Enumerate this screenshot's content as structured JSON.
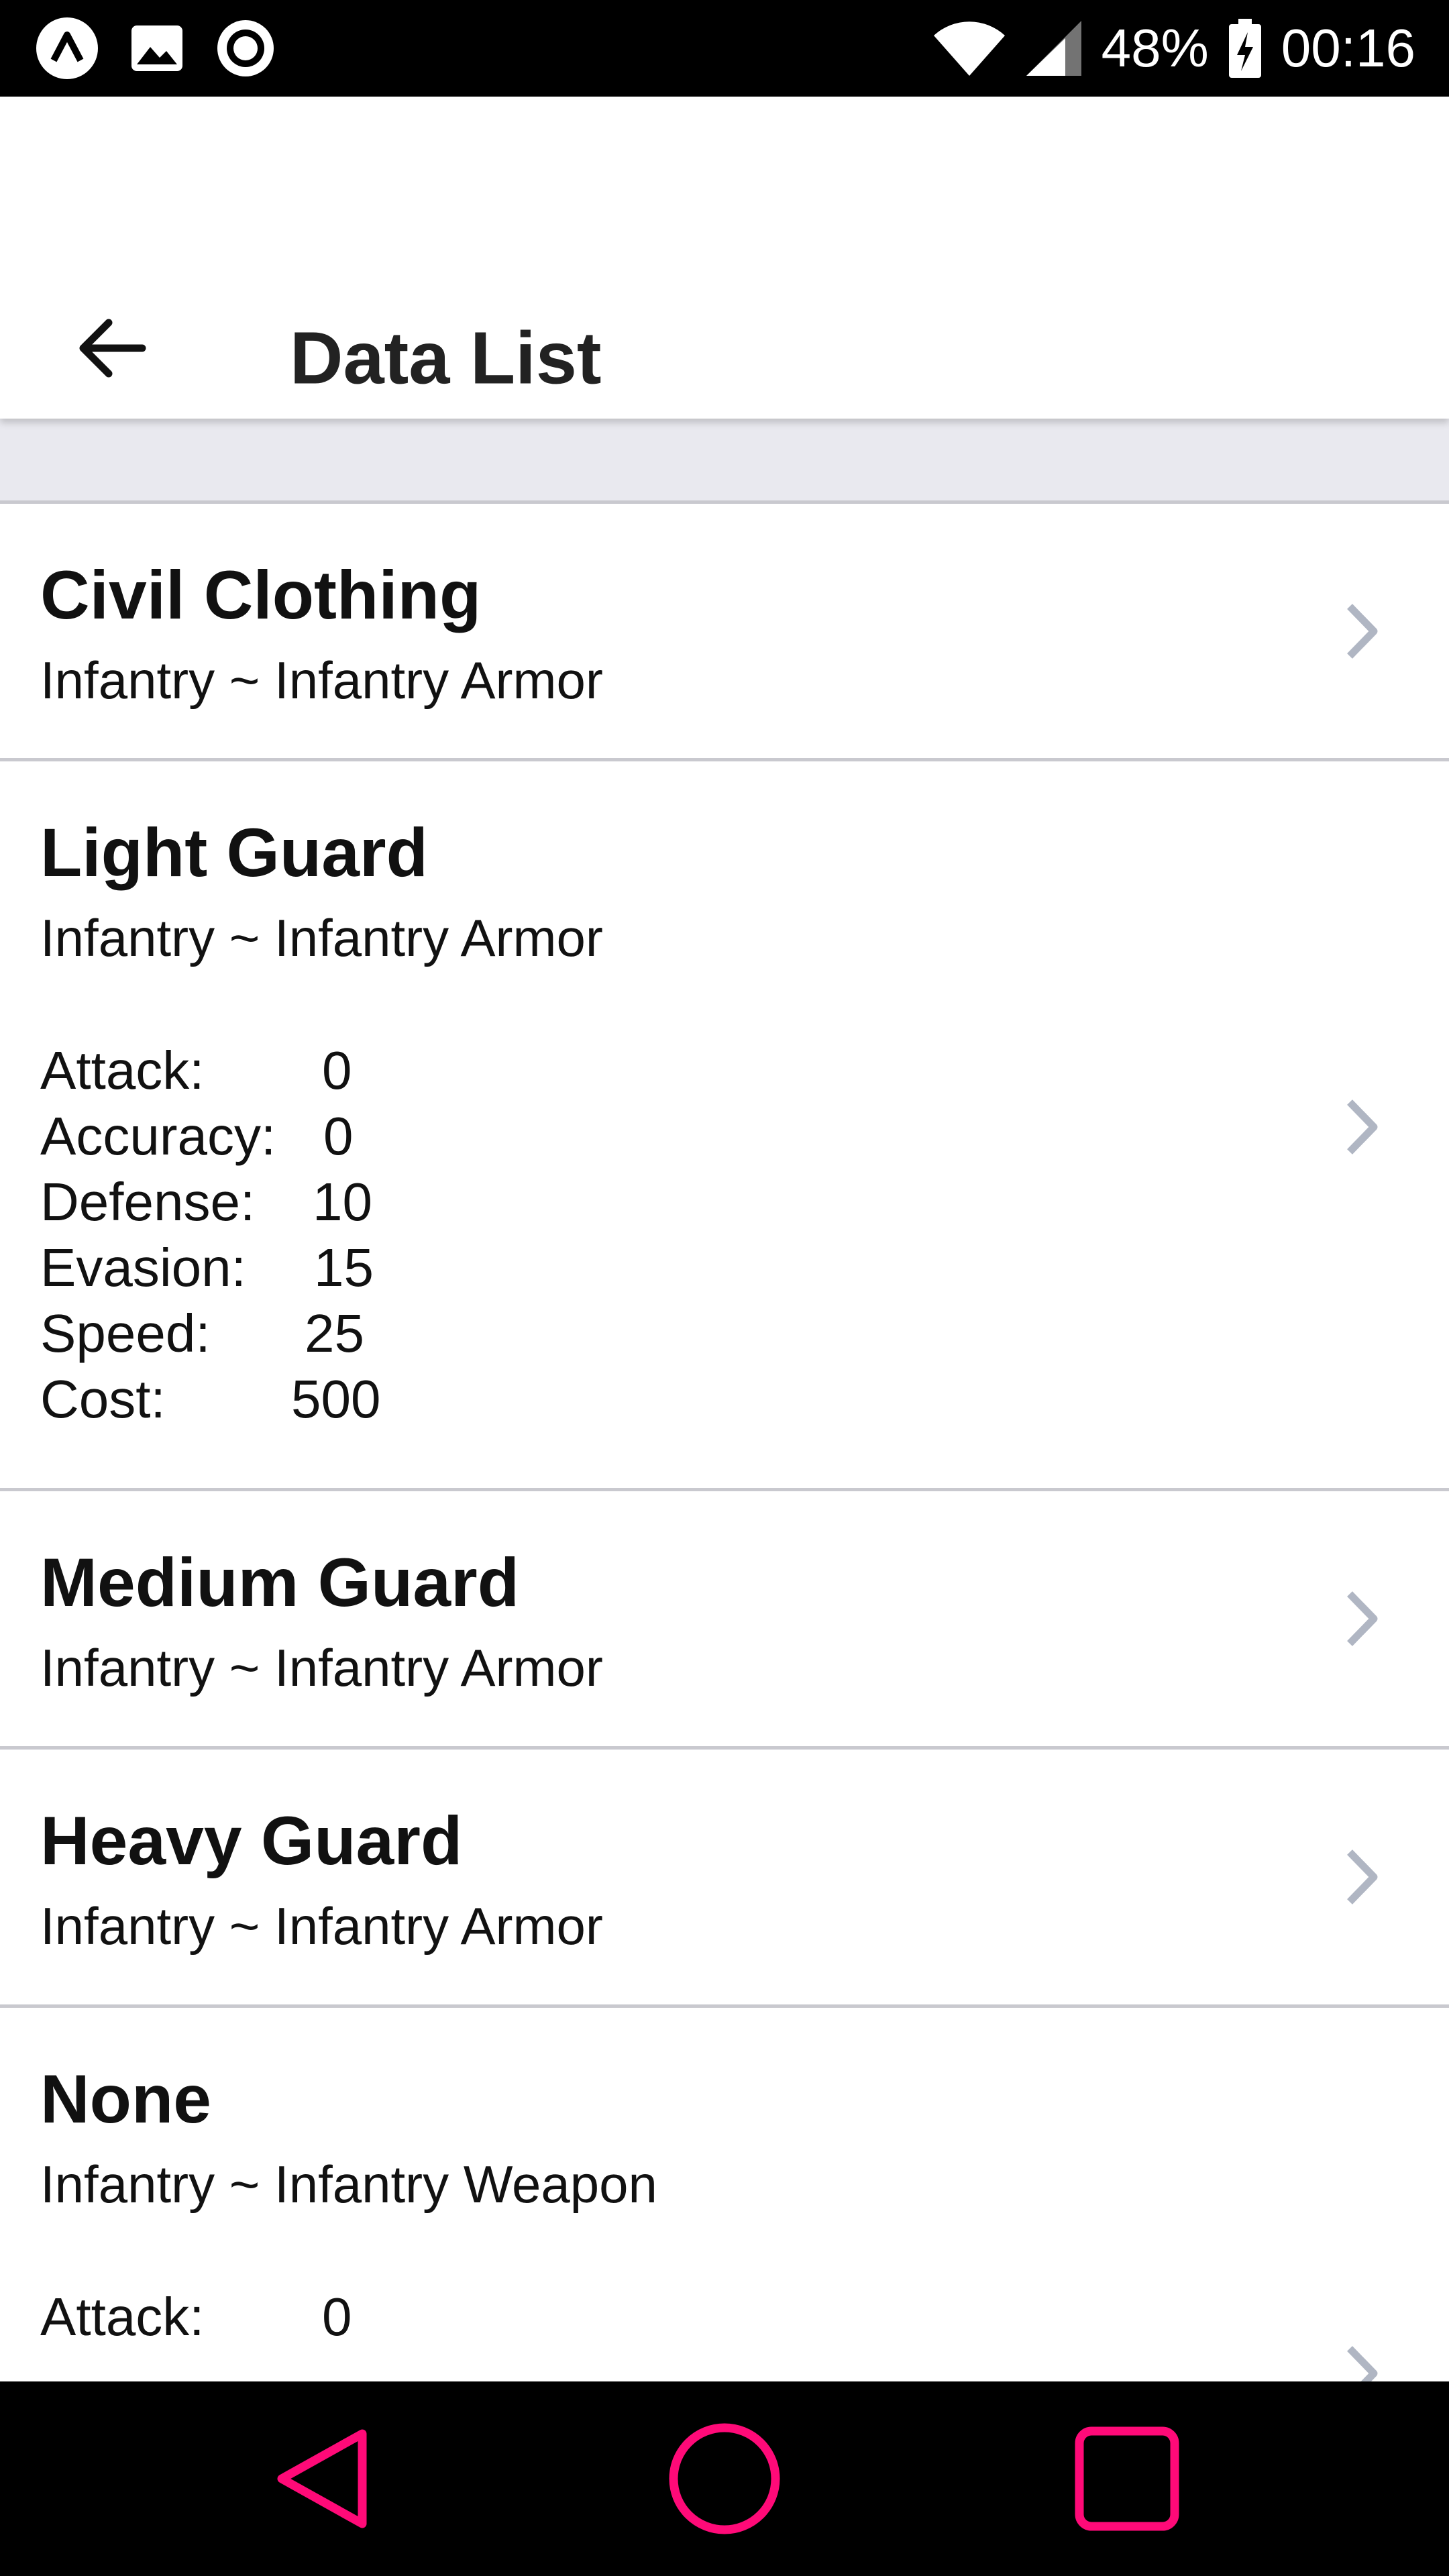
{
  "status_bar": {
    "battery": "48%",
    "time": "00:16",
    "icons": [
      "app-logo-icon",
      "image-icon",
      "record-icon",
      "wifi-icon",
      "signal-icon",
      "battery-charging-icon"
    ]
  },
  "app_bar": {
    "title": "Data List",
    "back_icon": "arrow-left-icon"
  },
  "items": [
    {
      "title": "Civil Clothing",
      "subtitle": "Infantry ~ Infantry Armor"
    },
    {
      "title": "Light Guard",
      "subtitle": "Infantry ~ Infantry Armor",
      "stats": [
        {
          "label": "Attack:",
          "value": "0"
        },
        {
          "label": "Accuracy:",
          "value": "0"
        },
        {
          "label": "Defense:",
          "value": "10"
        },
        {
          "label": "Evasion:",
          "value": "15"
        },
        {
          "label": "Speed:",
          "value": "25"
        },
        {
          "label": "Cost:",
          "value": "500"
        }
      ]
    },
    {
      "title": "Medium Guard",
      "subtitle": "Infantry ~ Infantry Armor"
    },
    {
      "title": "Heavy Guard",
      "subtitle": "Infantry ~ Infantry Armor"
    },
    {
      "title": "None",
      "subtitle": "Infantry ~ Infantry Weapon",
      "stats": [
        {
          "label": "Attack:",
          "value": "0"
        }
      ]
    }
  ],
  "nav_bar": {
    "icons": [
      "back-triangle-icon",
      "home-circle-icon",
      "recents-square-icon"
    ],
    "color": "#ff0a78"
  },
  "colors": {
    "divider": "#c9c9cf",
    "band": "#e9e9ef",
    "chevron": "#b0b6c3"
  }
}
